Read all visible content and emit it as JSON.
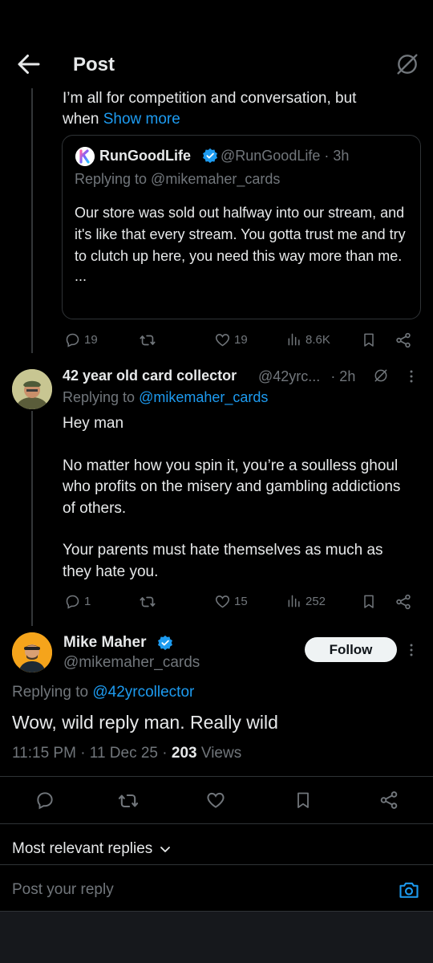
{
  "header": {
    "title": "Post"
  },
  "prev_post": {
    "text": "I’m all for competition and conversation, but",
    "text_cont": "when",
    "show_more": "Show more",
    "quote": {
      "name": "RunGoodLife",
      "handle": "@RunGoodLife",
      "time": "· 3h",
      "replying_label": "Replying to @mikemaher_cards",
      "body": "Our store was sold out halfway into our stream, and it's like that every stream. You gotta trust me and try to clutch up here, you need this way more than me.",
      "ellipsis": "..."
    },
    "stats": {
      "replies": "19",
      "likes": "19",
      "views": "8.6K"
    }
  },
  "reply_post": {
    "name": "42 year old card collector",
    "handle": "@42yrc...",
    "time": "· 2h",
    "replying_prefix": "Replying to",
    "replying_handle": "@mikemaher_cards",
    "para1": "Hey man",
    "para2": "No matter how you spin it, you’re a soulless ghoul who profits on the misery and gambling addictions of others.",
    "para3": "Your parents must hate themselves as much as they hate you.",
    "stats": {
      "replies": "1",
      "likes": "15",
      "views": "252"
    }
  },
  "main_post": {
    "name": "Mike Maher",
    "handle": "@mikemaher_cards",
    "follow_label": "Follow",
    "replying_prefix": "Replying to",
    "replying_handle": "@42yrcollector",
    "text": "Wow, wild reply man. Really wild",
    "time": "11:15 PM · 11 Dec 25 ·",
    "views_count": "203",
    "views_label": "Views"
  },
  "sort": {
    "label": "Most relevant replies"
  },
  "composer": {
    "placeholder": "Post your reply"
  },
  "colors": {
    "accent": "#1d9bf0",
    "background": "#000000",
    "text": "#e7e9ea",
    "muted": "#71767b"
  }
}
